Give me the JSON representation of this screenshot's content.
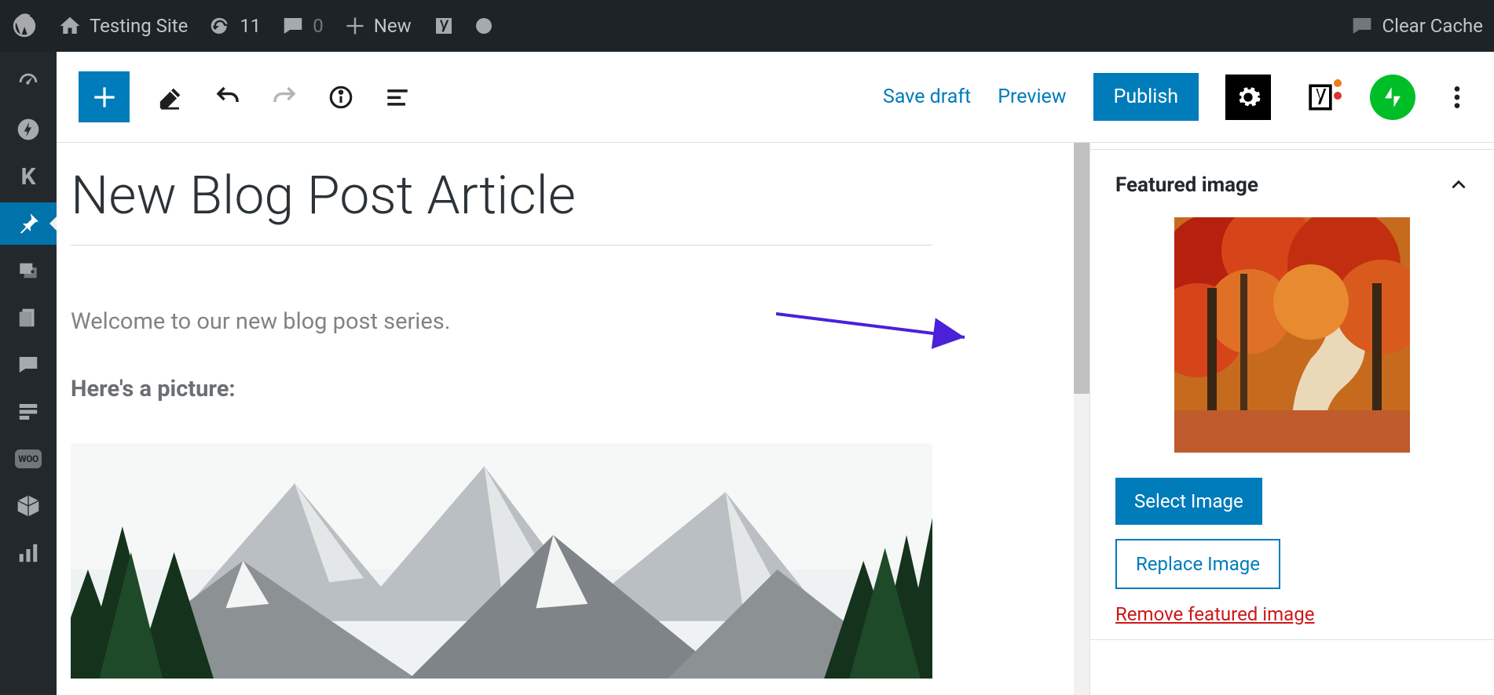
{
  "adminbar": {
    "site_name": "Testing Site",
    "updates": "11",
    "comments": "0",
    "new_label": "New",
    "clear_cache": "Clear Cache"
  },
  "toolbar": {
    "save_draft": "Save draft",
    "preview": "Preview",
    "publish": "Publish"
  },
  "editor": {
    "title": "New Blog Post Article",
    "para1": "Welcome to our new blog post series.",
    "para2": "Here's a picture:"
  },
  "sidebar": {
    "panel_title": "Featured image",
    "select_image": "Select Image",
    "replace_image": "Replace Image",
    "remove_image": "Remove featured image"
  }
}
